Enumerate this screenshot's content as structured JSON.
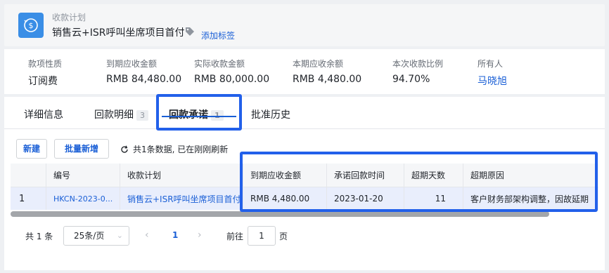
{
  "header": {
    "subtitle": "收款计划",
    "title": "销售云+ISR呼叫坐席项目首付",
    "add_tag": "添加标签"
  },
  "summary": [
    {
      "label": "款项性质",
      "value": "订阅费"
    },
    {
      "label": "到期应收金额",
      "value": "RMB 84,480.00"
    },
    {
      "label": "实际收款金额",
      "value": "RMB 80,000.00"
    },
    {
      "label": "本期应收余额",
      "value": "RMB 4,480.00"
    },
    {
      "label": "本次收款比例",
      "value": "94.70%"
    },
    {
      "label": "所有人",
      "value": "马晓旭"
    }
  ],
  "tabs": [
    {
      "label": "详细信息",
      "count": ""
    },
    {
      "label": "回款明细",
      "count": "3"
    },
    {
      "label": "回款承诺",
      "count": "1"
    },
    {
      "label": "批准历史",
      "count": ""
    }
  ],
  "toolbar": {
    "new_label": "新建",
    "batch_new_label": "批量新增",
    "refresh_text": "共1条数据, 已在刚刚刷新"
  },
  "table": {
    "headers": [
      "",
      "编号",
      "收款计划",
      "到期应收金额",
      "承诺回款时间",
      "超期天数",
      "超期原因"
    ],
    "rows": [
      [
        "1",
        "HKCN-2023-0...",
        "销售云+ISR呼叫坐席项目首付",
        "RMB 4,480.00",
        "2023-01-20",
        "11",
        "客户财务部架构调整，因故延期"
      ]
    ]
  },
  "pagination": {
    "total": "共 1 条",
    "page_size": "25条/页",
    "current_page": "1",
    "goto_label": "前往",
    "goto_value": "1",
    "goto_unit": "页"
  },
  "colors": {
    "accent": "#1a5fd6",
    "highlight": "#2260ea",
    "icon_bg": "#3a8ee6"
  },
  "icons": {
    "header": "refresh-currency-icon",
    "tag": "tag-icon",
    "refresh": "refresh-icon"
  }
}
